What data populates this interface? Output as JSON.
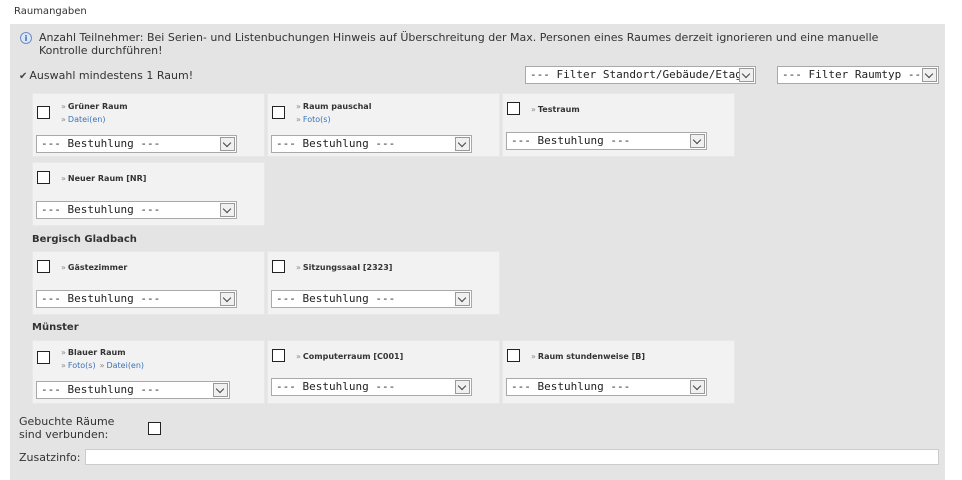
{
  "section": {
    "title": "Raumangaben"
  },
  "hint": {
    "text": "Anzahl Teilnehmer: Bei Serien- und Listenbuchungen Hinweis auf Überschreitung der Max. Personen eines Raumes derzeit ignorieren und eine manuelle Kontrolle durchführen!"
  },
  "requirement": {
    "text": "Auswahl mindestens 1 Raum!"
  },
  "filters": {
    "location": "--- Filter Standort/Gebäude/Etage ---",
    "roomtype": "--- Filter Raumtyp ---"
  },
  "seating_placeholder": "--- Bestuhlung ---",
  "link_marker": "»",
  "groups": [
    {
      "label": "",
      "rooms": [
        {
          "name": "Grüner Raum",
          "links": [
            "Datei(en)"
          ],
          "seating": "--- Bestuhlung ---"
        },
        {
          "name": "Raum pauschal",
          "links": [
            "Foto(s)"
          ],
          "seating": "--- Bestuhlung ---"
        },
        {
          "name": "Testraum",
          "links": [],
          "seating": "--- Bestuhlung ---"
        },
        {
          "name": "Neuer Raum [NR]",
          "links": [],
          "seating": "--- Bestuhlung ---"
        }
      ]
    },
    {
      "label": "Bergisch Gladbach",
      "rooms": [
        {
          "name": "Gästezimmer",
          "links": [],
          "seating": "--- Bestuhlung ---"
        },
        {
          "name": "Sitzungssaal [2323]",
          "links": [],
          "seating": "--- Bestuhlung ---"
        }
      ]
    },
    {
      "label": "Münster",
      "rooms": [
        {
          "name": "Blauer Raum",
          "links": [
            "Foto(s)",
            "Datei(en)"
          ],
          "seating": "--- Bestuhlung ---"
        },
        {
          "name": "Computerraum [C001]",
          "links": [],
          "seating": "--- Bestuhlung ---"
        },
        {
          "name": "Raum stundenweise [B]",
          "links": [],
          "seating": "--- Bestuhlung ---"
        }
      ]
    }
  ],
  "connected": {
    "label_line1": "Gebuchte Räume",
    "label_line2": "sind verbunden:"
  },
  "zusatz": {
    "label": "Zusatzinfo:",
    "value": ""
  }
}
